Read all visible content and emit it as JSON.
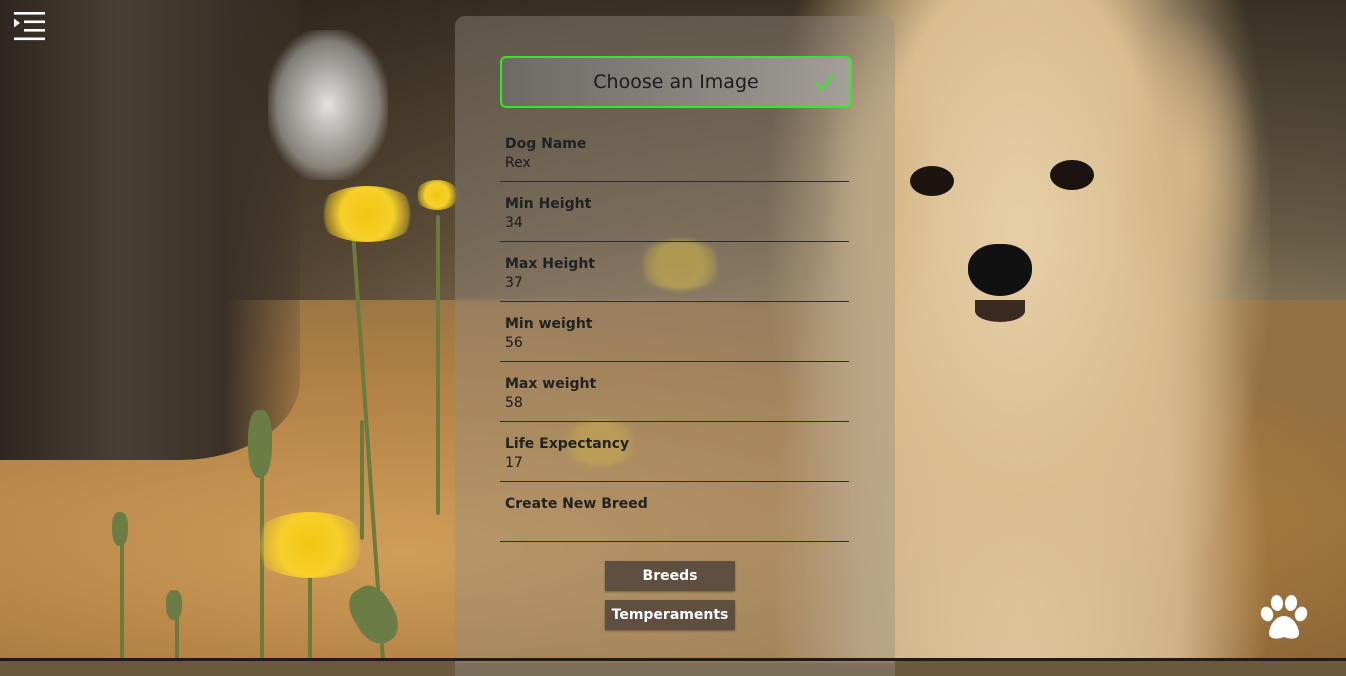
{
  "nav": {
    "menu_icon": "menu-indent-icon"
  },
  "form": {
    "choose_image_label": "Choose an Image",
    "choose_image_icon": "check-icon",
    "fields": [
      {
        "label": "Dog Name",
        "value": "Rex"
      },
      {
        "label": "Min Height",
        "value": "34"
      },
      {
        "label": "Max Height",
        "value": "37"
      },
      {
        "label": "Min weight",
        "value": "56"
      },
      {
        "label": "Max weight",
        "value": "58"
      },
      {
        "label": "Life Expectancy",
        "value": "17"
      },
      {
        "label": "Create New Breed",
        "value": ""
      }
    ]
  },
  "buttons": {
    "breeds": "Breeds",
    "temperaments": "Temperaments"
  },
  "footer": {
    "paw_icon": "paw-icon"
  },
  "colors": {
    "accent_border": "#35e62a",
    "button_bg": "#5e4f40",
    "button_text": "#ffffff"
  }
}
